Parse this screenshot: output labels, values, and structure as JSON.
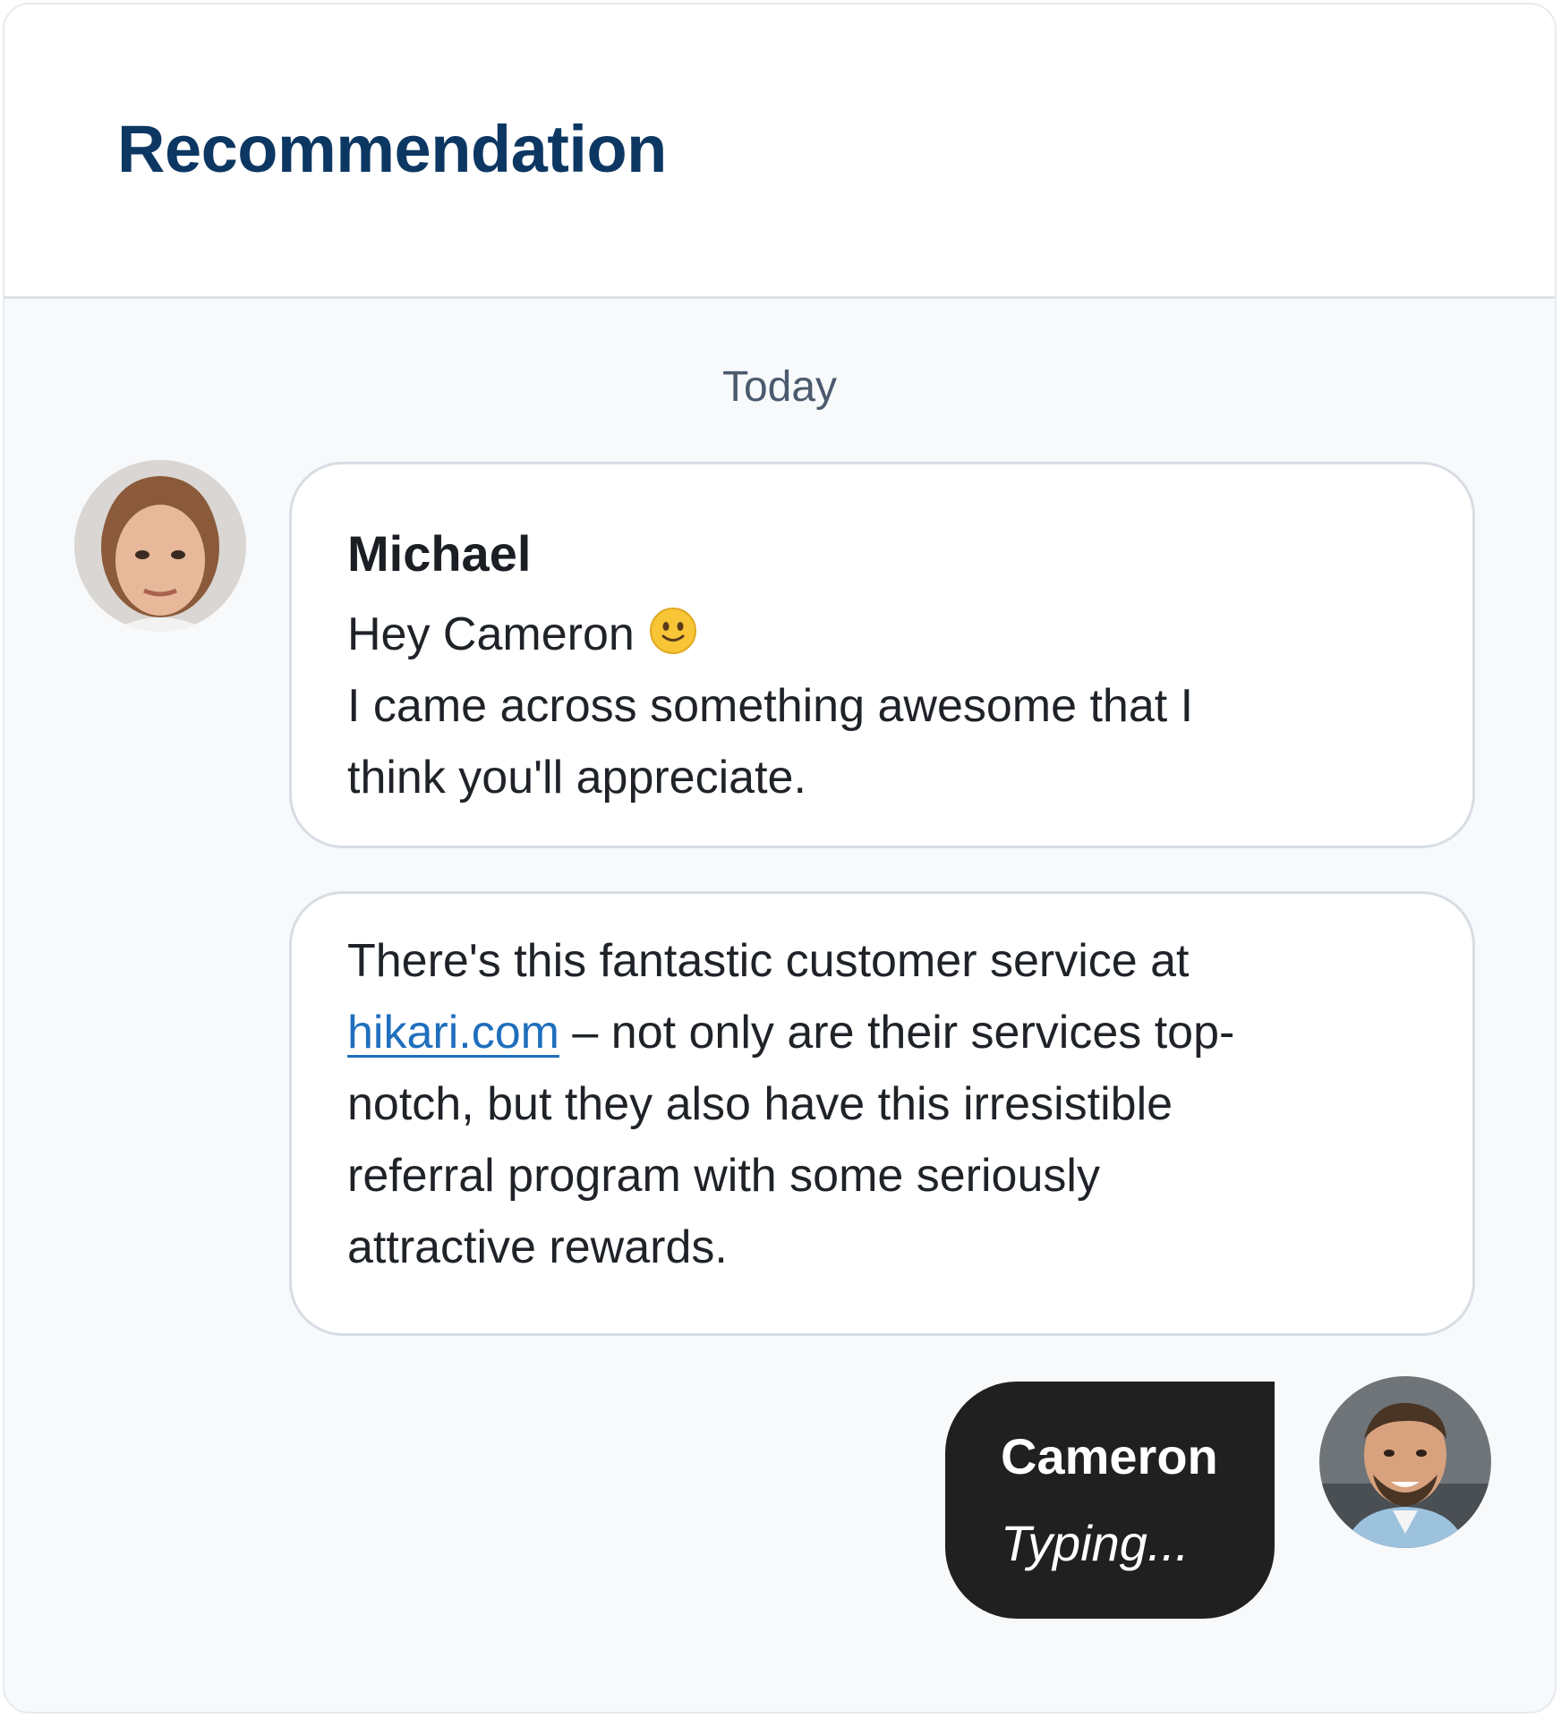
{
  "header": {
    "title": "Recommendation"
  },
  "divider": {
    "label": "Today"
  },
  "messages": [
    {
      "sender": "Michael",
      "lines": [
        "Hey Cameron",
        "I came across something awesome that I",
        "think you'll appreciate."
      ],
      "emoji": "slightly-smiling-face-icon"
    },
    {
      "pre_link": "There's this fantastic customer service at",
      "link": "hikari.com",
      "post_link_1": " – not only are their services top-",
      "line_3": "notch, but they also have this irresistible",
      "line_4": "referral program with some seriously",
      "line_5": "attractive rewards."
    }
  ],
  "typing": {
    "name": "Cameron",
    "status": "Typing..."
  },
  "colors": {
    "title": "#0c3762",
    "link": "#1f6fbd",
    "typing_bubble": "#202020"
  }
}
